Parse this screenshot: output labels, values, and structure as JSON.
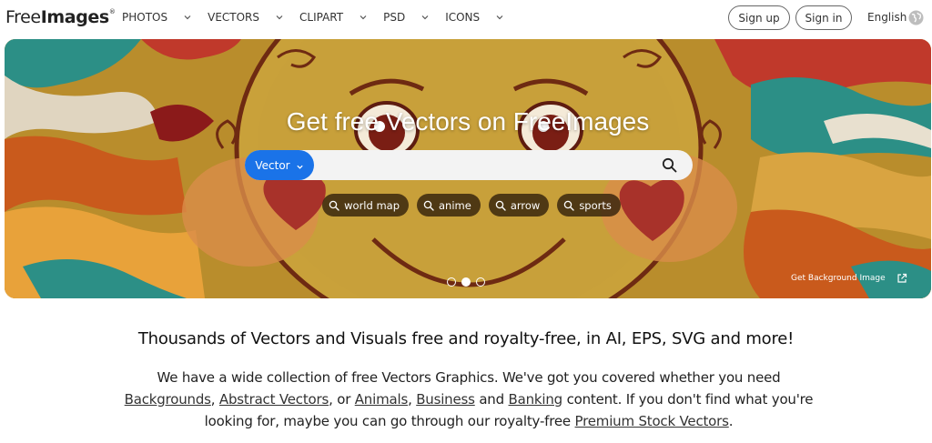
{
  "header": {
    "logo_part1": "Free",
    "logo_part2": "Images",
    "logo_mark": "®",
    "nav": [
      {
        "label": "PHOTOS"
      },
      {
        "label": "VECTORS"
      },
      {
        "label": "CLIPART"
      },
      {
        "label": "PSD"
      },
      {
        "label": "ICONS"
      }
    ],
    "signup_label": "Sign up",
    "signin_label": "Sign in",
    "language": "English",
    "globe_icon": "globe-icon"
  },
  "hero": {
    "title": "Get free Vectors on FreeImages",
    "search": {
      "type_label": "Vector",
      "value": "",
      "placeholder": "",
      "icon": "search-icon"
    },
    "tags": [
      {
        "label": "world map"
      },
      {
        "label": "anime"
      },
      {
        "label": "arrow"
      },
      {
        "label": "sports"
      }
    ],
    "carousel_active_index": 1,
    "carousel_count": 3,
    "bg_link_label": "Get Background Image",
    "colors": {
      "accent": "#1a73e8",
      "background": "#b98d2c"
    }
  },
  "content": {
    "headline": "Thousands of Vectors and Visuals free and royalty-free, in AI, EPS, SVG and more!",
    "p_part1": "We have a wide collection of free Vectors Graphics. We've got you covered whether you need ",
    "link_backgrounds": "Backgrounds",
    "p_sep1": ", ",
    "link_abstract": "Abstract Vectors",
    "p_sep2": ", or ",
    "link_animals": "Animals",
    "p_sep3": ", ",
    "link_business": "Business",
    "p_sep4": " and ",
    "link_banking": "Banking",
    "p_part2": " content. If you don't find what you're looking for, maybe you can go through our royalty-free ",
    "link_premium": "Premium Stock Vectors",
    "p_end": "."
  }
}
